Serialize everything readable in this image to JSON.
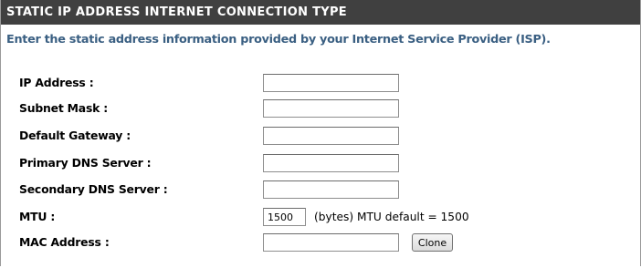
{
  "section": {
    "title": "STATIC IP ADDRESS INTERNET CONNECTION TYPE",
    "intro": "Enter the static address information provided by your Internet Service Provider (ISP)."
  },
  "fields": {
    "ip_address": {
      "label": "IP Address :",
      "value": ""
    },
    "subnet_mask": {
      "label": "Subnet Mask :",
      "value": ""
    },
    "default_gateway": {
      "label": "Default Gateway :",
      "value": ""
    },
    "primary_dns": {
      "label": "Primary DNS Server :",
      "value": ""
    },
    "secondary_dns": {
      "label": "Secondary DNS Server :",
      "value": ""
    },
    "mtu": {
      "label": "MTU :",
      "value": "1500",
      "note": "(bytes) MTU default = 1500"
    },
    "mac_address": {
      "label": "MAC Address :",
      "value": "",
      "clone_label": "Clone"
    }
  },
  "colors": {
    "header_bg": "#404040",
    "header_text": "#ffffff",
    "intro_text": "#3a5f82"
  }
}
